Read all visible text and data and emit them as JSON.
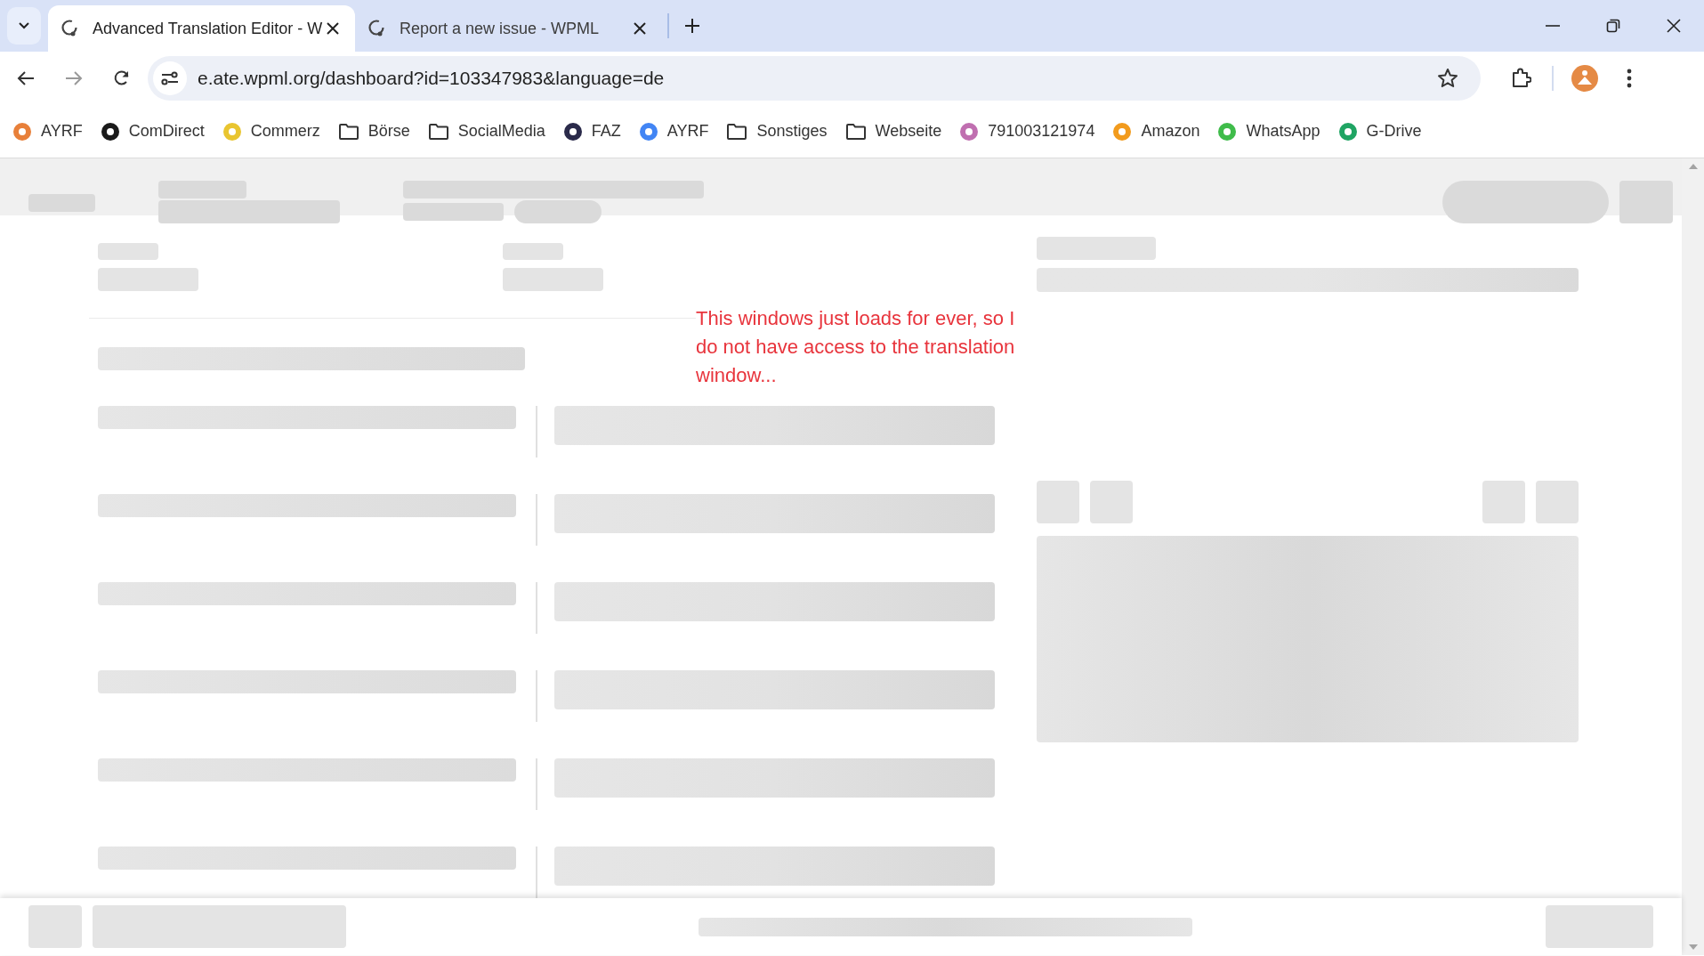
{
  "tabs": [
    {
      "title": "Advanced Translation Editor - W",
      "selected": true
    },
    {
      "title": "Report a new issue - WPML",
      "selected": false
    }
  ],
  "address_bar": {
    "url": "e.ate.wpml.org/dashboard?id=103347983&language=de"
  },
  "bookmarks": [
    {
      "label": "AYRF",
      "kind": "site",
      "color": "#e8803a"
    },
    {
      "label": "ComDirect",
      "kind": "site",
      "color": "#1a1a1a"
    },
    {
      "label": "Commerz",
      "kind": "site",
      "color": "#e9c530"
    },
    {
      "label": "Börse",
      "kind": "folder"
    },
    {
      "label": "SocialMedia",
      "kind": "folder"
    },
    {
      "label": "FAZ",
      "kind": "site",
      "color": "#2a2a4a"
    },
    {
      "label": "AYRF",
      "kind": "site",
      "color": "#4285f4"
    },
    {
      "label": "Sonstiges",
      "kind": "folder"
    },
    {
      "label": "Webseite",
      "kind": "folder"
    },
    {
      "label": "791003121974",
      "kind": "site",
      "color": "#c06fb0"
    },
    {
      "label": "Amazon",
      "kind": "site",
      "color": "#f29b1d"
    },
    {
      "label": "WhatsApp",
      "kind": "site",
      "color": "#3fbc4a"
    },
    {
      "label": "G-Drive",
      "kind": "site",
      "color": "#1fa463"
    }
  ],
  "annotation": {
    "lines": [
      "This windows just loads for ever, so I",
      "do not have access to the translation",
      "window..."
    ]
  }
}
